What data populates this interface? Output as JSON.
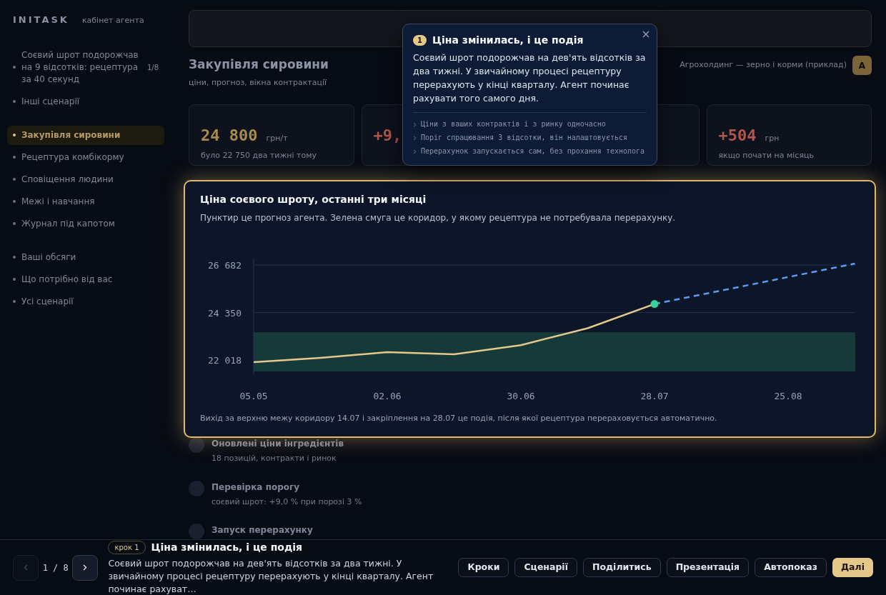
{
  "brand": {
    "logo": "INITASK",
    "subtitle": "кабінет агента"
  },
  "sidebar": {
    "sections": [
      {
        "items": [
          {
            "label": "Соєвий шрот подорожчав на 9 відсотків: рецептура за 40 секунд",
            "badge": "1/8",
            "selected": false
          },
          {
            "label": "Інші сценарії",
            "selected": false
          }
        ]
      },
      {
        "items": [
          {
            "label": "Закупівля сировини",
            "selected": true
          },
          {
            "label": "Рецептура комбікорму",
            "selected": false
          },
          {
            "label": "Сповіщення людини",
            "selected": false
          },
          {
            "label": "Межі і навчання",
            "selected": false
          },
          {
            "label": "Журнал під капотом",
            "selected": false
          }
        ]
      },
      {
        "items": [
          {
            "label": "Ваші обсяги",
            "selected": false
          },
          {
            "label": "Що потрібно від вас",
            "selected": false
          },
          {
            "label": "Усі сценарії",
            "selected": false
          }
        ]
      }
    ]
  },
  "header": {
    "title": "Закупівля сировини",
    "subtitle": "ціни, прогноз, вікна контрактації",
    "company": "Агрохолдинг — зерно і корми (приклад)",
    "avatar": "А"
  },
  "kpis": [
    {
      "value": "24 800",
      "unit": "грн/т",
      "note": "було 22 750 два тижні тому",
      "color": "#a88a4e"
    },
    {
      "value": "+9,",
      "color": "#b0564a"
    },
    {
      "value": "+504",
      "unit": "грн",
      "note": "якщо почати на місяць",
      "color": "#b0564a"
    }
  ],
  "chart_card": {
    "title": "Ціна соєвого шроту, останні три місяці",
    "subtitle": "Пунктир це прогноз агента. Зелена смуга це коридор, у якому рецептура не потребувала перерахунку.",
    "footnote": "Вихід за верхню межу коридору 14.07 і закріплення на 28.07 це подія, після якої рецептура перераховується автоматично.",
    "chart_data": {
      "type": "line",
      "categories": [
        "05.05",
        null,
        "02.06",
        null,
        "30.06",
        null,
        "28.07",
        null,
        "25.08",
        null
      ],
      "series": [
        {
          "color": "#e6c88a",
          "line_style": "solid",
          "values": [
            21910,
            22120,
            22400,
            22300,
            22750,
            23580,
            24770,
            null,
            null,
            null
          ]
        },
        {
          "color": "#5b9cf0",
          "line_style": "dashed",
          "values": [
            null,
            null,
            null,
            null,
            null,
            null,
            24770,
            25430,
            26090,
            26750
          ]
        }
      ],
      "grid": true,
      "ylim": [
        21300,
        27000
      ],
      "bands": [
        {
          "axis": "y",
          "from": 21460,
          "to": 23380,
          "color": "#163a3a"
        }
      ],
      "yticks": [
        {
          "value": 22018,
          "label": "22 018"
        },
        {
          "value": 24350,
          "label": "24 350"
        },
        {
          "value": 26682,
          "label": "26 682"
        }
      ]
    }
  },
  "steps": [
    {
      "title": "Оновлені ціни інгредієнтів",
      "subtitle": "18 позицій, контракти і ринок"
    },
    {
      "title": "Перевірка порогу",
      "subtitle": "соєвий шрот: +9,0 % при порозі 3 %"
    },
    {
      "title": "Запуск перерахунку"
    }
  ],
  "popover": {
    "number": "1",
    "title": "Ціна змінилась, і це подія",
    "body": "Соєвий шрот подорожчав на дев'ять відсотків за два тижні. У звичайному процесі рецептуру перерахують у кінці кварталу. Агент починає рахувати того самого дня.",
    "points": [
      "Ціни з ваших контрактів і з ринку одночасно",
      "Поріг спрацювання 3 відсотки, він налаштовується",
      "Перерахунок запускається сам, без прохання технолога"
    ]
  },
  "footer": {
    "prev_disabled": true,
    "counter": "1 / 8",
    "step_badge": "крок 1",
    "title": "Ціна змінилась, і це подія",
    "text": "Соєвий шрот подорожчав на дев'ять відсотків за два тижні. У звичайному процесі рецептуру перерахують у кінці кварталу. Агент починає рахуват…",
    "buttons": [
      {
        "label": "Кроки",
        "kind": "outline"
      },
      {
        "label": "Сценарії",
        "kind": "outline"
      },
      {
        "label": "Поділитись",
        "kind": "outline"
      },
      {
        "label": "Презентація",
        "kind": "outline"
      },
      {
        "label": "Автопоказ",
        "kind": "outline"
      },
      {
        "label": "Далі",
        "kind": "primary"
      }
    ]
  }
}
